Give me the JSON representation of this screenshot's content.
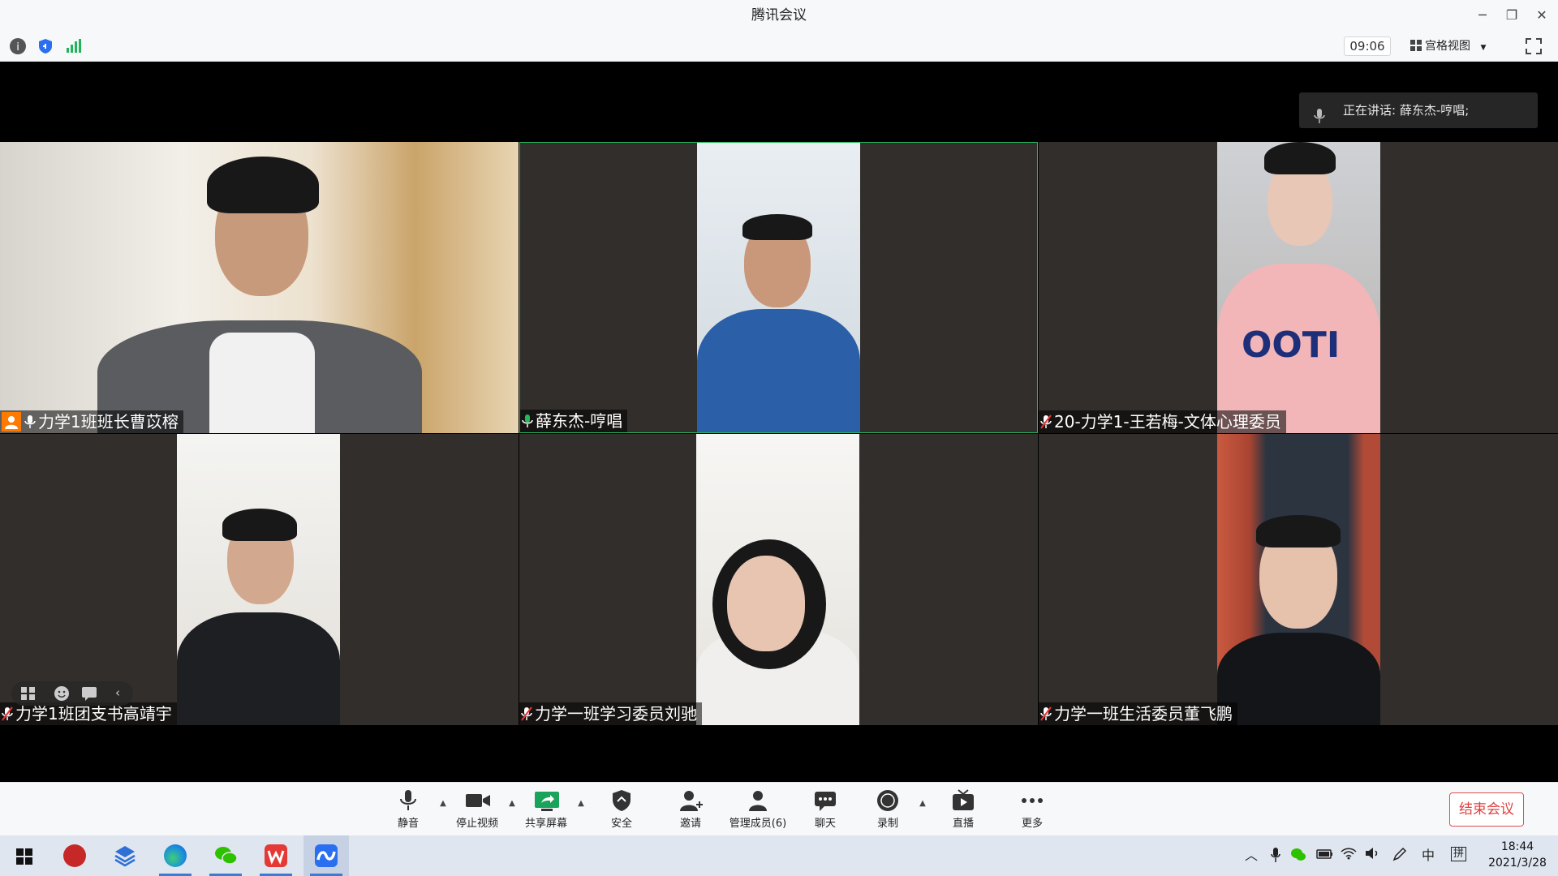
{
  "window": {
    "title": "腾讯会议"
  },
  "infobar": {
    "timer": "09:06",
    "view_mode": "宫格视图"
  },
  "speaking": {
    "label": "正在讲话: 薛东杰-哼唱;"
  },
  "participants": [
    {
      "name": "力学1班班长曹苡榕",
      "host": true,
      "mic": "on"
    },
    {
      "name": "薛东杰-哼唱",
      "host": false,
      "mic": "on",
      "active": true
    },
    {
      "name": "20-力学1-王若梅-文体心理委员",
      "host": false,
      "mic": "muted"
    },
    {
      "name": "力学1班团支书高靖宇",
      "host": false,
      "mic": "muted"
    },
    {
      "name": "力学一班学习委员刘驰",
      "host": false,
      "mic": "muted"
    },
    {
      "name": "力学一班生活委员董飞鹏",
      "host": false,
      "mic": "muted"
    }
  ],
  "toolbar": {
    "mute": "静音",
    "stop_video": "停止视频",
    "share_screen": "共享屏幕",
    "security": "安全",
    "invite": "邀请",
    "manage_members": "管理成员(6)",
    "chat": "聊天",
    "record": "录制",
    "live": "直播",
    "more": "更多",
    "end_meeting": "结束会议"
  },
  "taskbar": {
    "apps": [
      "start",
      "dev-c++",
      "layers-app",
      "edge",
      "wechat",
      "wps",
      "tencent-meeting"
    ],
    "tray_ime_lang": "中",
    "tray_ime_mode": "拼",
    "clock_time": "18:44",
    "clock_date": "2021/3/28"
  },
  "colors": {
    "accent_green": "#27b85c",
    "end_red": "#e04040",
    "tile_bg": "#312e2b"
  }
}
